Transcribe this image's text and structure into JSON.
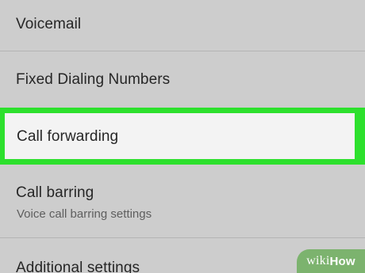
{
  "settings": {
    "items": [
      {
        "title": "Voicemail"
      },
      {
        "title": "Fixed Dialing Numbers"
      },
      {
        "title": "Call forwarding",
        "highlighted": true
      },
      {
        "title": "Call barring",
        "subtitle": "Voice call barring settings"
      },
      {
        "title": "Additional settings"
      }
    ]
  },
  "watermark": {
    "wiki": "wiki",
    "how": "How"
  },
  "colors": {
    "background": "#cdcdcd",
    "highlight_border": "#2de02d",
    "highlight_fill": "#f3f3f3",
    "title_text": "#262626",
    "subtitle_text": "#5e5e5e",
    "divider": "#b4b4b4",
    "watermark_bg": "#7cb36e"
  }
}
